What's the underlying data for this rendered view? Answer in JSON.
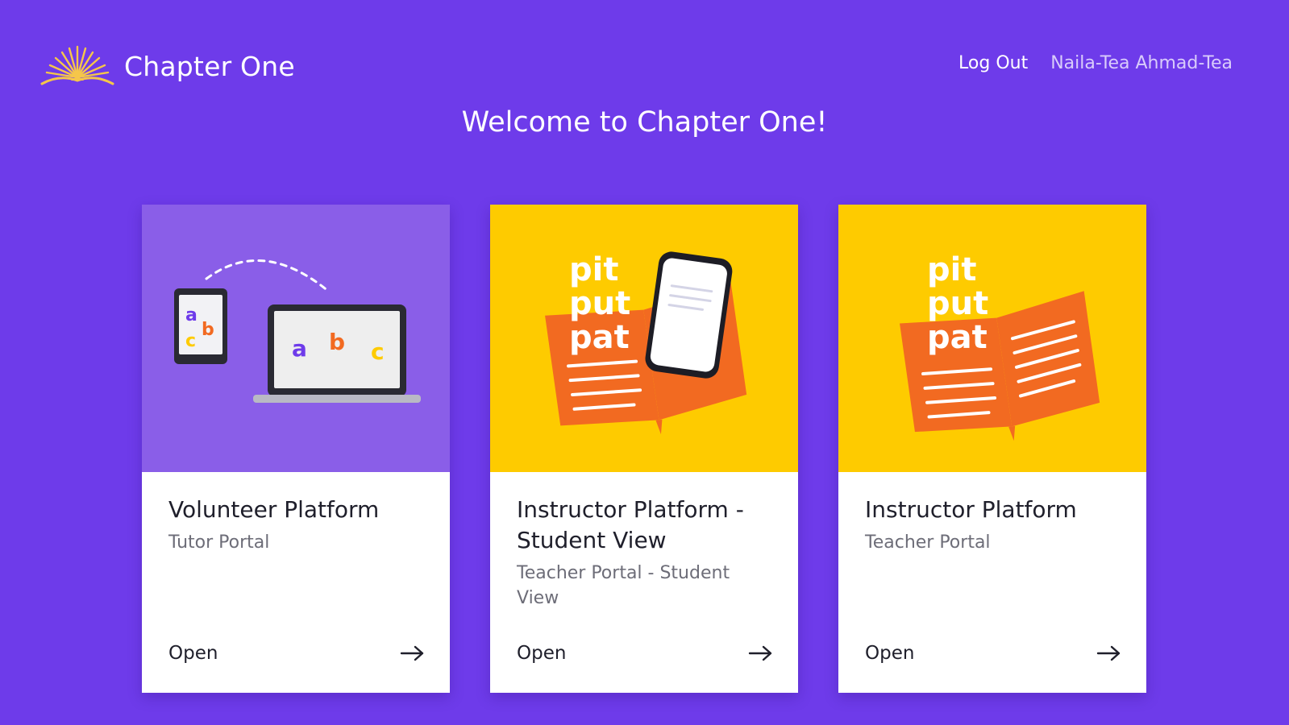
{
  "header": {
    "brand_name": "Chapter One",
    "logout_label": "Log Out",
    "user_name": "Naila-Tea Ahmad-Tea"
  },
  "welcome": "Welcome to Chapter One!",
  "colors": {
    "background": "#6e3bea",
    "card_lavender": "#8a5ee8",
    "card_yellow": "#fecb00",
    "book_orange": "#f26a21",
    "logo_gold": "#f5c64a"
  },
  "cards": [
    {
      "title": "Volunteer Platform",
      "subtitle": "Tutor Portal",
      "open_label": "Open",
      "art_icon": "devices-illustration",
      "art_letters": [
        "a",
        "b",
        "c"
      ]
    },
    {
      "title": "Instructor Platform - Student View",
      "subtitle": "Teacher Portal - Student View",
      "open_label": "Open",
      "art_icon": "book-phone-illustration",
      "art_words": [
        "pit",
        "put",
        "pat"
      ]
    },
    {
      "title": "Instructor Platform",
      "subtitle": "Teacher Portal",
      "open_label": "Open",
      "art_icon": "book-illustration",
      "art_words": [
        "pit",
        "put",
        "pat"
      ]
    }
  ]
}
